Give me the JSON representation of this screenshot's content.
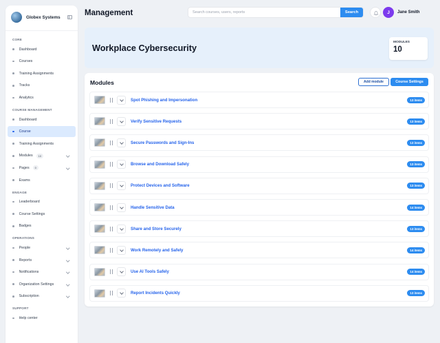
{
  "app": {
    "name": "Globex Systems"
  },
  "header": {
    "title": "Management",
    "search_placeholder": "Search courses, users, reports",
    "search_button": "Search",
    "user": {
      "initial": "J",
      "name": "Jane Smith"
    }
  },
  "sidebar": {
    "sections": [
      {
        "title": "CORE",
        "items": [
          {
            "label": "Dashboard"
          },
          {
            "label": "Courses"
          },
          {
            "label": "Training Assignments"
          },
          {
            "label": "Tracks"
          },
          {
            "label": "Analytics"
          }
        ]
      },
      {
        "title": "COURSE MANAGEMENT",
        "items": [
          {
            "label": "Dashboard"
          },
          {
            "label": "Course",
            "active": true
          },
          {
            "label": "Training Assignments"
          },
          {
            "label": "Modules",
            "badge": "10"
          },
          {
            "label": "Pages",
            "badge": "0"
          },
          {
            "label": "Exams"
          }
        ]
      },
      {
        "title": "ENGAGE",
        "items": [
          {
            "label": "Leaderboard"
          },
          {
            "label": "Course Settings"
          },
          {
            "label": "Badges"
          }
        ]
      },
      {
        "title": "OPERATIONS",
        "items": [
          {
            "label": "People"
          },
          {
            "label": "Reports"
          },
          {
            "label": "Notifications"
          },
          {
            "label": "Organization Settings"
          },
          {
            "label": "Subscription"
          }
        ]
      },
      {
        "title": "SUPPORT",
        "items": [
          {
            "label": "Help center"
          }
        ]
      }
    ]
  },
  "hero": {
    "title": "Workplace Cybersecurity",
    "stat_label": "MODULES",
    "stat_value": "10"
  },
  "modules": {
    "title": "Modules",
    "add_button": "Add module",
    "settings_button": "Course Settings",
    "items": [
      {
        "name": "Spot Phishing and Impersonation",
        "items": "13 items"
      },
      {
        "name": "Verify Sensitive Requests",
        "items": "13 items"
      },
      {
        "name": "Secure Passwords and Sign-Ins",
        "items": "13 items"
      },
      {
        "name": "Browse and Download Safely",
        "items": "13 items"
      },
      {
        "name": "Protect Devices and Software",
        "items": "13 items"
      },
      {
        "name": "Handle Sensitive Data",
        "items": "14 items"
      },
      {
        "name": "Share and Store Securely",
        "items": "13 items"
      },
      {
        "name": "Work Remotely and Safely",
        "items": "14 items"
      },
      {
        "name": "Use AI Tools Safely",
        "items": "14 items"
      },
      {
        "name": "Report Incidents Quickly",
        "items": "13 items"
      }
    ]
  },
  "colors": {
    "accent": "#2d8cf0",
    "avatar": "#7c3aed",
    "hero_bg": "#e6f0fb",
    "active_nav": "#dbeafe"
  }
}
